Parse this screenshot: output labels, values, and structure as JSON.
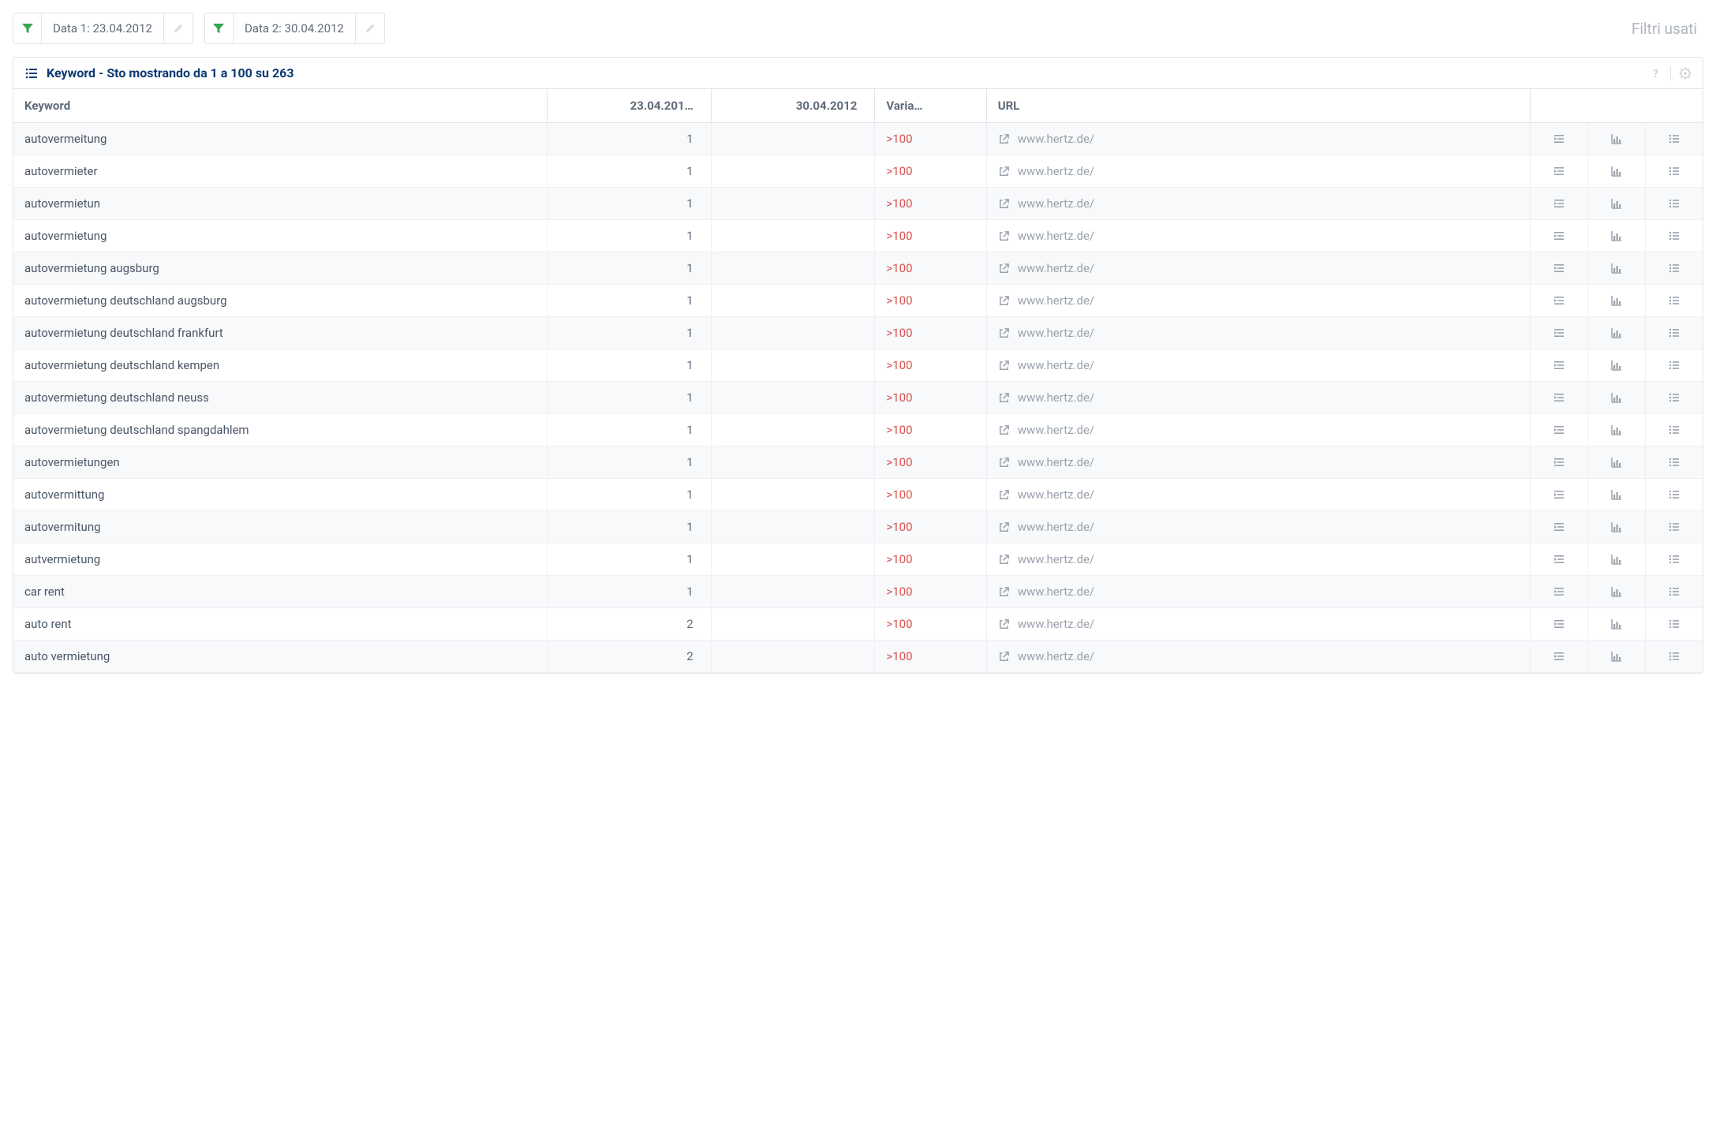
{
  "toolbar": {
    "filter1_label": "Data 1: 23.04.2012",
    "filter2_label": "Data 2: 30.04.2012",
    "filters_used_label": "Filtri usati"
  },
  "panel": {
    "title": "Keyword - Sto mostrando da 1 a 100 su 263"
  },
  "table": {
    "columns": {
      "keyword": "Keyword",
      "date1": "23.04.201…",
      "date2": "30.04.2012",
      "variation": "Varia…",
      "url": "URL"
    },
    "rows": [
      {
        "keyword": "autovermeitung",
        "d1": "1",
        "d2": "",
        "var": ">100",
        "url": "www.hertz.de/"
      },
      {
        "keyword": "autovermieter",
        "d1": "1",
        "d2": "",
        "var": ">100",
        "url": "www.hertz.de/"
      },
      {
        "keyword": "autovermietun",
        "d1": "1",
        "d2": "",
        "var": ">100",
        "url": "www.hertz.de/"
      },
      {
        "keyword": "autovermietung",
        "d1": "1",
        "d2": "",
        "var": ">100",
        "url": "www.hertz.de/"
      },
      {
        "keyword": "autovermietung augsburg",
        "d1": "1",
        "d2": "",
        "var": ">100",
        "url": "www.hertz.de/"
      },
      {
        "keyword": "autovermietung deutschland augsburg",
        "d1": "1",
        "d2": "",
        "var": ">100",
        "url": "www.hertz.de/"
      },
      {
        "keyword": "autovermietung deutschland frankfurt",
        "d1": "1",
        "d2": "",
        "var": ">100",
        "url": "www.hertz.de/"
      },
      {
        "keyword": "autovermietung deutschland kempen",
        "d1": "1",
        "d2": "",
        "var": ">100",
        "url": "www.hertz.de/"
      },
      {
        "keyword": "autovermietung deutschland neuss",
        "d1": "1",
        "d2": "",
        "var": ">100",
        "url": "www.hertz.de/"
      },
      {
        "keyword": "autovermietung deutschland spangdahlem",
        "d1": "1",
        "d2": "",
        "var": ">100",
        "url": "www.hertz.de/"
      },
      {
        "keyword": "autovermietungen",
        "d1": "1",
        "d2": "",
        "var": ">100",
        "url": "www.hertz.de/"
      },
      {
        "keyword": "autovermittung",
        "d1": "1",
        "d2": "",
        "var": ">100",
        "url": "www.hertz.de/"
      },
      {
        "keyword": "autovermitung",
        "d1": "1",
        "d2": "",
        "var": ">100",
        "url": "www.hertz.de/"
      },
      {
        "keyword": "autvermietung",
        "d1": "1",
        "d2": "",
        "var": ">100",
        "url": "www.hertz.de/"
      },
      {
        "keyword": "car rent",
        "d1": "1",
        "d2": "",
        "var": ">100",
        "url": "www.hertz.de/"
      },
      {
        "keyword": "auto rent",
        "d1": "2",
        "d2": "",
        "var": ">100",
        "url": "www.hertz.de/"
      },
      {
        "keyword": "auto vermietung",
        "d1": "2",
        "d2": "",
        "var": ">100",
        "url": "www.hertz.de/"
      }
    ]
  }
}
